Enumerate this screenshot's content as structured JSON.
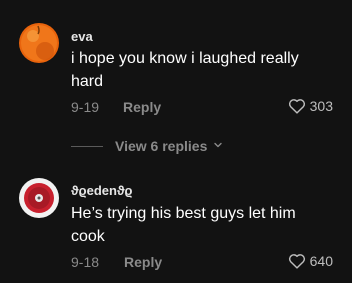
{
  "comments": [
    {
      "username": "eva",
      "text": "i hope you know i laughed really hard",
      "date": "9-19",
      "reply_label": "Reply",
      "likes": "303",
      "avatar_icon": "orange-avatar-icon"
    },
    {
      "username": "ϑϱedenϑϱ",
      "text": "He’s trying his best guys let him cook",
      "date": "9-18",
      "reply_label": "Reply",
      "likes": "640",
      "avatar_icon": "red-vinyl-avatar-icon"
    }
  ],
  "view_replies": {
    "label": "View 6 replies"
  },
  "colors": {
    "background": "#121212",
    "muted_text": "#8a8a8a",
    "primary_text": "#ffffff"
  }
}
